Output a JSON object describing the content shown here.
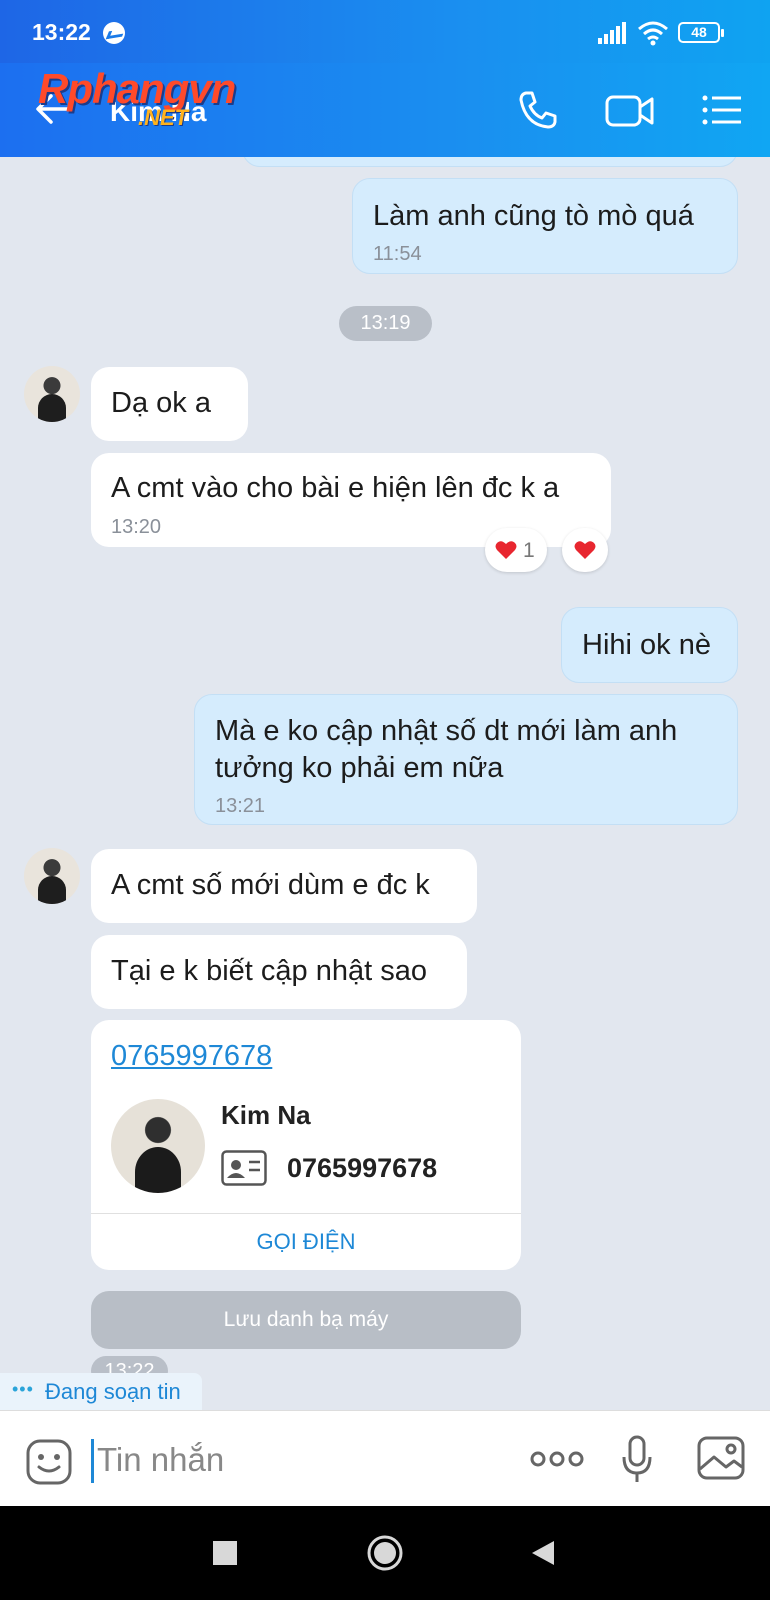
{
  "status_bar": {
    "time": "13:22",
    "battery": "48"
  },
  "header": {
    "contact_name": "Kim Na",
    "watermark_main": "Rphangvn",
    "watermark_sub": ".NET"
  },
  "messages": [
    {
      "dir": "out",
      "text": "Làm anh cũng tò mò quá",
      "time": "11:54"
    },
    {
      "type": "time_separator",
      "text": "13:19"
    },
    {
      "dir": "in",
      "text": "Dạ ok a"
    },
    {
      "dir": "in",
      "text": "A cmt vào cho bài e hiện lên đc k a",
      "time": "13:20",
      "reaction_count": "1"
    },
    {
      "dir": "out",
      "text": "Hihi ok nè"
    },
    {
      "dir": "out",
      "text": "Mà e ko cập nhật số dt mới làm anh tưởng ko phải em nữa",
      "time": "13:21"
    },
    {
      "dir": "in",
      "text": "A cmt số mới dùm e đc k"
    },
    {
      "dir": "in",
      "text": "Tại e k biết cập nhật sao"
    }
  ],
  "contact_card": {
    "phone_link": "0765997678",
    "name": "Kim Na",
    "phone": "0765997678",
    "call_label": "GỌI ĐIỆN"
  },
  "save_contact_label": "Lưu danh bạ máy",
  "partial_time": "13:22",
  "typing_indicator": "Đang soạn tin",
  "input": {
    "placeholder": "Tin nhắn",
    "value": ""
  },
  "icons": [
    "messenger-icon",
    "signal-icon",
    "wifi-icon",
    "battery-icon",
    "back-icon",
    "phone-icon",
    "video-icon",
    "menu-icon",
    "emoji-icon",
    "more-icon",
    "microphone-icon",
    "image-icon",
    "heart-icon",
    "id-card-icon",
    "nav-recent-icon",
    "nav-home-icon",
    "nav-back-icon"
  ],
  "colors": {
    "header_blue": "#1a8ff0",
    "out_bubble": "#d5ecfd",
    "in_bubble": "#ffffff",
    "chat_bg": "#e2e7ef",
    "link_blue": "#1e88d6"
  }
}
